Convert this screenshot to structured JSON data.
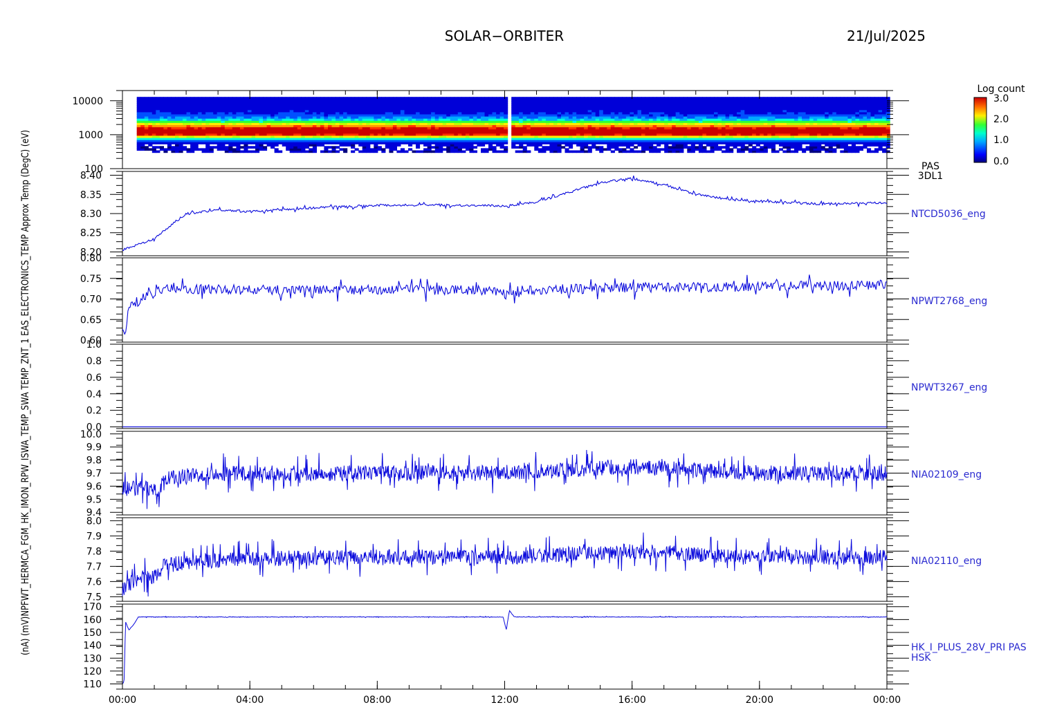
{
  "header": {
    "title": "SOLAR−ORBITER",
    "date": "21/Jul/2025"
  },
  "colors": {
    "trace": "#0a0adc",
    "label": "#2a2ad0",
    "axis": "#000000"
  },
  "colorbar": {
    "title": "Log count",
    "ticks": [
      "3.0",
      "2.0",
      "1.0",
      "0.0"
    ],
    "range": [
      0,
      3
    ]
  },
  "x_axis": {
    "tick_labels": [
      "00:00",
      "04:00",
      "08:00",
      "12:00",
      "16:00",
      "20:00",
      "00:00"
    ],
    "range_hours": [
      0,
      24
    ]
  },
  "left_axis_text": "(nA) (mV)NPFWT_HERMCA_FGM_HK_IMON_RPW_ISWA_TEMP_SWA TEMP_ZNT_1 EAS_ELECTRONICS_TEMP Approx Temp (DegC) (eV)",
  "chart_data": [
    {
      "type": "heatmap",
      "name": "PAS 3DL1",
      "labels": [
        "PAS",
        "3DL1"
      ],
      "ylabel": "(eV)",
      "yscale": "log",
      "ylim": [
        100,
        20000
      ],
      "yticks": [
        "10000",
        "1000",
        "100"
      ],
      "x_range_hours": [
        0.45,
        24
      ],
      "peak_energy_eV": 1200,
      "energy_band_eV": [
        300,
        13000
      ],
      "gap_at_hours": 12.1,
      "colorbar_range": [
        0,
        3
      ]
    },
    {
      "type": "line",
      "name": "NTCD5036_eng",
      "ylim": [
        8.19,
        8.41
      ],
      "yticks": [
        "8.40",
        "8.35",
        "8.30",
        "8.25",
        "8.20"
      ],
      "x_hours": [
        0,
        1,
        2,
        3,
        4,
        6,
        8,
        10,
        12,
        13,
        14,
        15,
        16,
        17,
        18,
        19,
        20,
        22,
        24
      ],
      "values": [
        8.205,
        8.235,
        8.3,
        8.31,
        8.305,
        8.315,
        8.322,
        8.322,
        8.32,
        8.33,
        8.355,
        8.38,
        8.392,
        8.375,
        8.35,
        8.338,
        8.332,
        8.325,
        8.328
      ],
      "noise": 0.003
    },
    {
      "type": "line",
      "name": "NPWT2768_eng",
      "ylim": [
        0.595,
        0.8
      ],
      "yticks": [
        "0.80",
        "0.75",
        "0.70",
        "0.65",
        "0.60"
      ],
      "x_hours": [
        0,
        0.1,
        0.2,
        0.5,
        1,
        1.5,
        4,
        8,
        11.5,
        12.1,
        12.5,
        16,
        20,
        24
      ],
      "values": [
        0.625,
        0.625,
        0.68,
        0.695,
        0.715,
        0.725,
        0.722,
        0.722,
        0.722,
        0.71,
        0.722,
        0.728,
        0.73,
        0.735
      ],
      "noise": 0.012
    },
    {
      "type": "line",
      "name": "NPWT3267_eng",
      "ylim": [
        -0.02,
        1.0
      ],
      "yticks": [
        "1.0",
        "0.8",
        "0.6",
        "0.4",
        "0.2",
        "0.0"
      ],
      "x_hours": [
        0,
        24
      ],
      "values": [
        0.0,
        0.0
      ],
      "noise": 0
    },
    {
      "type": "line",
      "name": "NIA02109_eng",
      "ylim": [
        9.38,
        10.02
      ],
      "yticks": [
        "10.0",
        "9.9",
        "9.8",
        "9.7",
        "9.6",
        "9.5",
        "9.4"
      ],
      "x_hours": [
        0,
        1.2,
        1.3,
        2.6,
        4,
        8,
        12,
        16,
        20,
        24
      ],
      "values": [
        9.58,
        9.58,
        9.65,
        9.7,
        9.7,
        9.7,
        9.7,
        9.75,
        9.7,
        9.7
      ],
      "noise": 0.06
    },
    {
      "type": "line",
      "name": "NIA02110_eng",
      "ylim": [
        7.47,
        8.02
      ],
      "yticks": [
        "8.0",
        "7.9",
        "7.8",
        "7.7",
        "7.6",
        "7.5"
      ],
      "x_hours": [
        0,
        0.1,
        0.3,
        0.6,
        1,
        1.3,
        2,
        4,
        8,
        12,
        16,
        20,
        24
      ],
      "values": [
        7.54,
        7.56,
        7.6,
        7.63,
        7.63,
        7.7,
        7.73,
        7.75,
        7.76,
        7.76,
        7.8,
        7.76,
        7.76
      ],
      "noise": 0.05
    },
    {
      "type": "line",
      "name": "HK_I_PLUS_28V_PRI PAS HSK",
      "labels": [
        "HK_I_PLUS_28V_PRI PAS",
        "HSK"
      ],
      "ylim": [
        106,
        172
      ],
      "yticks": [
        "170",
        "160",
        "150",
        "140",
        "130",
        "120",
        "110"
      ],
      "x_hours": [
        0,
        0.05,
        0.1,
        0.2,
        0.35,
        0.5,
        11.95,
        12.05,
        12.15,
        12.3,
        24
      ],
      "values": [
        110,
        112,
        158,
        152,
        156,
        162,
        162,
        152,
        167,
        162,
        162
      ],
      "noise": 0.2
    }
  ]
}
